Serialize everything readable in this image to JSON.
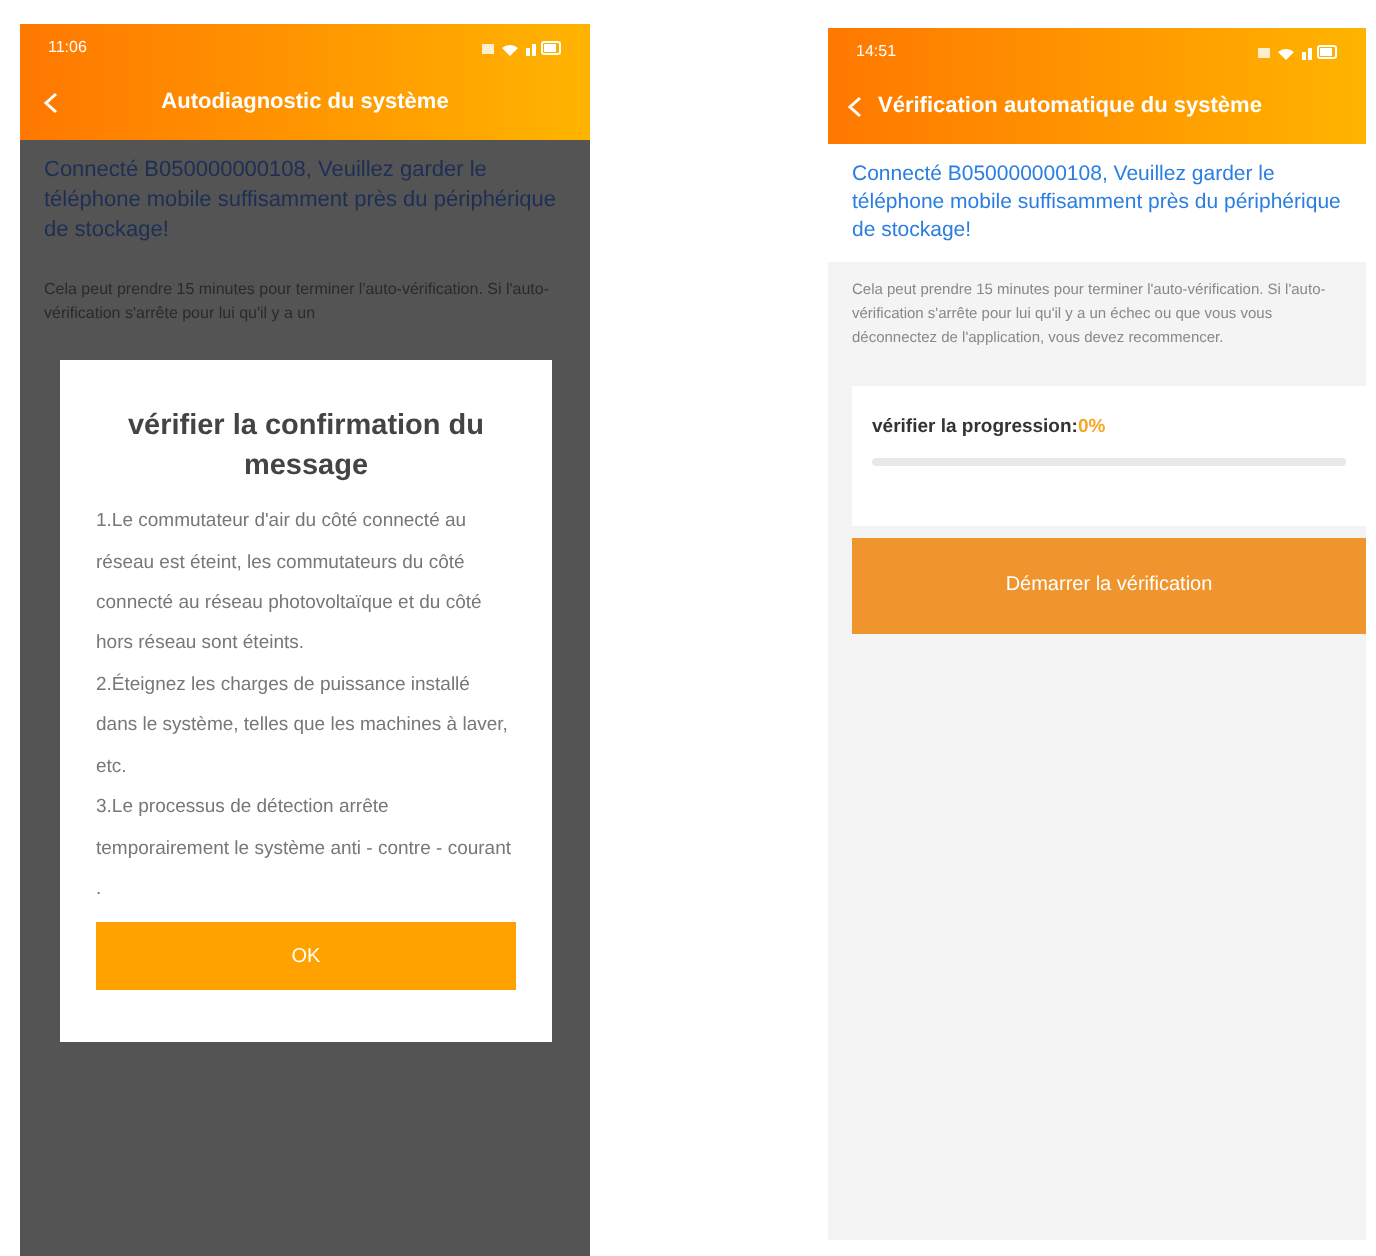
{
  "screens": [
    {
      "status_bar": {
        "time": "11:06"
      },
      "header": {
        "title": "Autodiagnostic du système"
      },
      "notice": "Connecté B050000000108, Veuillez garder le téléphone mobile suffisamment près du périphérique de stockage!",
      "description": "Cela peut prendre 15 minutes pour terminer l'auto-vérification. Si l'auto-vérification s'arrête pour lui qu'il y a un",
      "dimmed": true,
      "dialog": {
        "title": "vérifier la confirmation du message",
        "lines": [
          "1.Le commutateur d'air du côté connecté au réseau est éteint, les commutateurs du côté connecté au réseau photovoltaïque et du côté hors réseau sont éteints.",
          "2.Éteignez les charges de puissance installé dans le système, telles que les machines à laver, etc.",
          "3.Le processus de détection arrête temporairement le système anti - contre - courant ."
        ],
        "button": "OK"
      }
    },
    {
      "status_bar": {
        "time": "14:51"
      },
      "header": {
        "title": "Vérification automatique du système"
      },
      "notice": "Connecté B050000000108, Veuillez garder le téléphone mobile suffisamment près du périphérique de stockage!",
      "description": "Cela peut prendre 15 minutes pour terminer l'auto-vérification. Si l'auto-vérification s'arrête pour lui qu'il y a un échec ou que vous vous déconnectez de l'application, vous devez recommencer.",
      "dimmed": false,
      "progress": {
        "label": "vérifier la progression:",
        "value": "0%",
        "level": 0
      },
      "button": "Démarrer la vérification"
    }
  ]
}
